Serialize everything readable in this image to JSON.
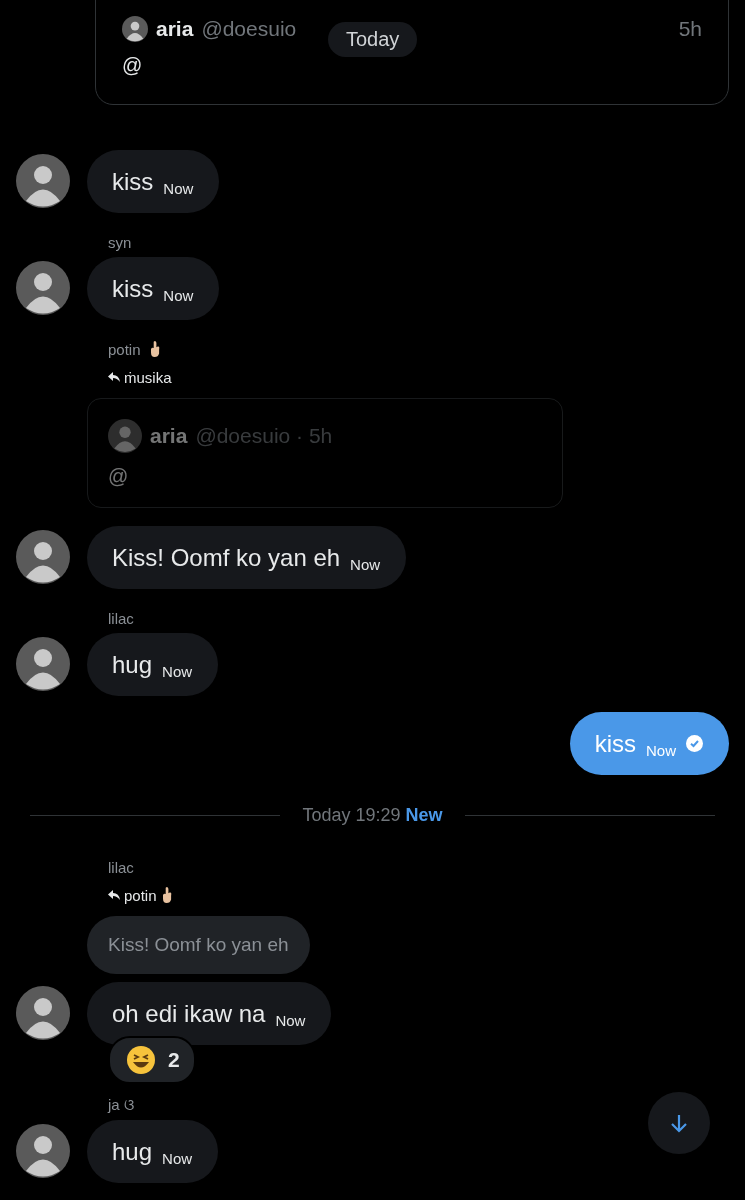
{
  "date_pill": "Today",
  "items": [
    {
      "kind": "quote_card",
      "name": "aria",
      "handle": "@doesuio",
      "time": "5h",
      "body": "@"
    },
    {
      "kind": "message",
      "text": "kiss",
      "time": "Now",
      "avatar": true
    },
    {
      "kind": "sender",
      "name": "syn",
      "emoji_badge": false
    },
    {
      "kind": "message",
      "text": "kiss",
      "time": "Now",
      "avatar": true
    },
    {
      "kind": "sender",
      "name": "potin",
      "emoji_badge": true
    },
    {
      "kind": "reply_to",
      "name": "ṁusika",
      "emoji_badge": false
    },
    {
      "kind": "quoted_post",
      "name": "aria",
      "handle": "@doesuio · 5h",
      "body": "@"
    },
    {
      "kind": "message",
      "text": "Kiss! Oomf ko yan eh",
      "time": "Now",
      "avatar": true
    },
    {
      "kind": "sender",
      "name": "lilac",
      "emoji_badge": false
    },
    {
      "kind": "message",
      "text": "hug",
      "time": "Now",
      "avatar": true
    },
    {
      "kind": "own_message",
      "text": "kiss",
      "time": "Now",
      "seen": true
    },
    {
      "kind": "date_divider",
      "label": "Today 19:29",
      "flag": "New"
    },
    {
      "kind": "sender",
      "name": "lilac",
      "emoji_badge": false
    },
    {
      "kind": "reply_to",
      "name": "potin",
      "emoji_badge": true
    },
    {
      "kind": "reply_preview",
      "text": "Kiss! Oomf ko yan eh"
    },
    {
      "kind": "message",
      "text": "oh edi ikaw na",
      "time": "Now",
      "avatar": true,
      "reactions": [
        {
          "count": "2"
        }
      ]
    },
    {
      "kind": "sender",
      "name": "ja ଓ",
      "emoji_badge": false
    },
    {
      "kind": "message",
      "text": "hug",
      "time": "Now",
      "avatar": true
    }
  ]
}
